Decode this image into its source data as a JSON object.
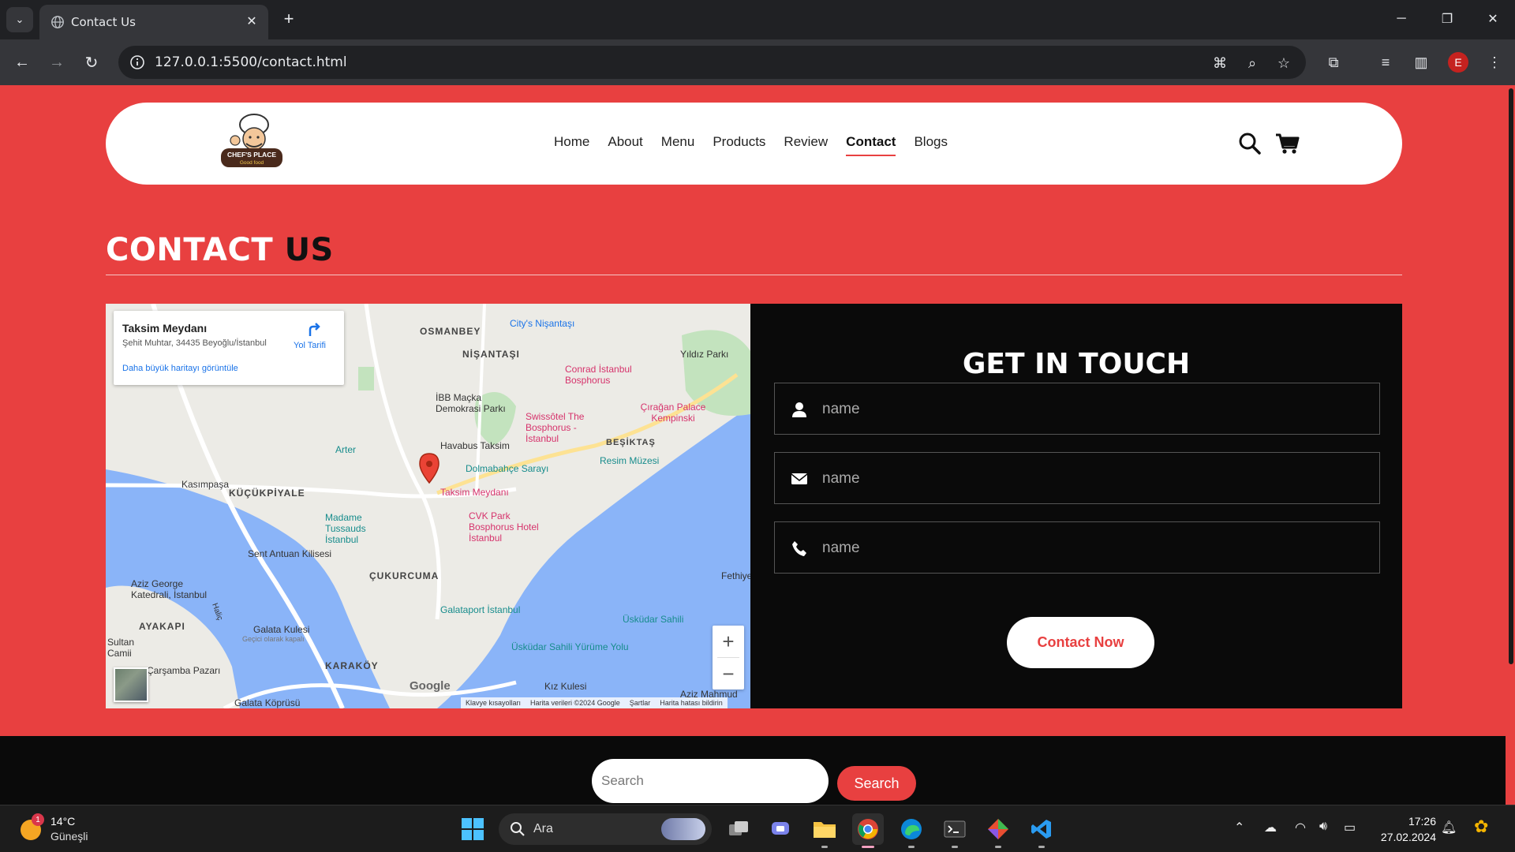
{
  "browser": {
    "tab_title": "Contact Us",
    "url": "127.0.0.1:5500/contact.html",
    "profile_initial": "E"
  },
  "site": {
    "logo_alt": "CHEF'S PLACE Good food",
    "logo_line1": "CHEF'S PLACE",
    "logo_line2": "Good food",
    "nav": [
      "Home",
      "About",
      "Menu",
      "Products",
      "Review",
      "Contact",
      "Blogs"
    ],
    "active_nav": "Contact",
    "accent": "#e84040"
  },
  "contact": {
    "title_word1": "CONTACT",
    "title_word2": "US",
    "form_title": "GET IN TOUCH",
    "fields": [
      {
        "icon": "user-icon",
        "placeholder": "name"
      },
      {
        "icon": "envelope-icon",
        "placeholder": "name"
      },
      {
        "icon": "phone-icon",
        "placeholder": "name"
      }
    ],
    "submit_label": "Contact Now"
  },
  "map": {
    "card_name": "Taksim Meydanı",
    "card_address": "Şehit Muhtar, 34435 Beyoğlu/İstanbul",
    "card_bigger_link": "Daha büyük haritayı görüntüle",
    "card_directions": "Yol Tarifi",
    "labels": [
      "City's Nişantaşı",
      "OSMANBEY",
      "NİŞANTAŞI",
      "Yıldız Parkı",
      "Conrad İstanbul Bosphorus",
      "İBB Maçka Demokrasi Parkı",
      "Çırağan Palace Kempinski",
      "Swissôtel The Bosphorus - İstanbul",
      "BEŞİKTAŞ",
      "Arter",
      "Havabus Taksim",
      "Dolmabahçe Sarayı",
      "Resim Müzesi",
      "Kasımpaşa",
      "KÜÇÜKPİYALE",
      "Taksim Meydanı",
      "Madame Tussauds İstanbul",
      "CVK Park Bosphorus Hotel İstanbul",
      "Sent Antuan Kilisesi",
      "ÇUKURCUMA",
      "Aziz George Katedrali, İstanbul",
      "Fethiye",
      "Galataport İstanbul",
      "Üsküdar Sahili",
      "AYAKAPI",
      "Galata Kulesi",
      "Geçici olarak kapalı",
      "Sultan Camii",
      "Üsküdar Sahili Yürüme Yolu",
      "Çarşamba Pazarı",
      "KARAKÖY",
      "Kız Kulesi",
      "Aziz Mahmud",
      "Galata Köprüsü",
      "Haliç"
    ],
    "google": "Google",
    "attribution": [
      "Klavye kısayolları",
      "Harita verileri ©2024 Google",
      "Şartlar",
      "Harita hatası bildirin"
    ]
  },
  "footer": {
    "search_placeholder": "Search",
    "search_button": "Search"
  },
  "taskbar": {
    "temp": "14°C",
    "condition": "Güneşli",
    "weather_badge": "1",
    "search_text": "Ara",
    "time": "17:26",
    "date": "27.02.2024"
  }
}
